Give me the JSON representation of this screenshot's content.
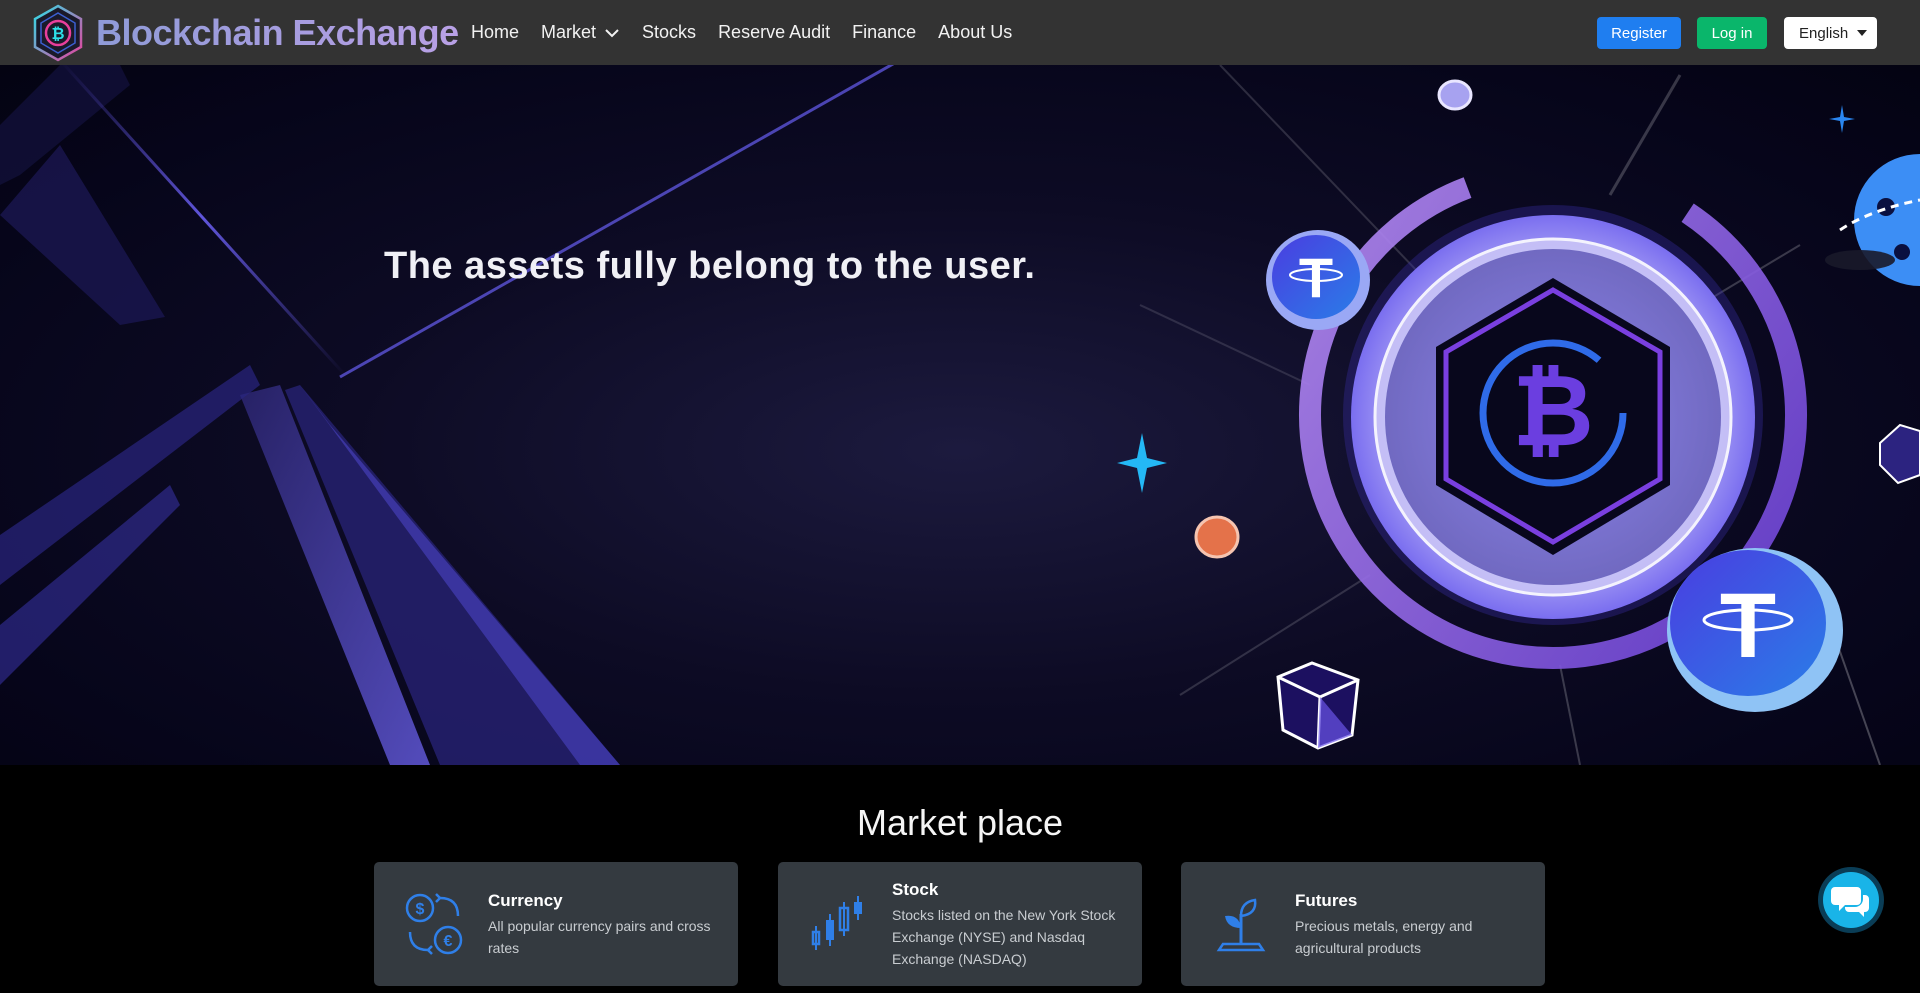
{
  "navbar": {
    "brand_title": "Blockchain Exchange",
    "logo_icon": "bitcoin-hexagon-icon",
    "menu": [
      {
        "label": "Home"
      },
      {
        "label": "Market",
        "has_dropdown": true
      },
      {
        "label": "Stocks"
      },
      {
        "label": "Reserve Audit"
      },
      {
        "label": "Finance"
      },
      {
        "label": "About Us"
      }
    ],
    "register_label": "Register",
    "login_label": "Log in",
    "language": "English"
  },
  "hero": {
    "headline": "The assets fully belong to the user."
  },
  "market": {
    "heading": "Market place",
    "cards": [
      {
        "title": "Currency",
        "description": "All popular currency pairs and cross rates",
        "icon": "currency-exchange-icon"
      },
      {
        "title": "Stock",
        "description": "Stocks listed on the New York Stock Exchange (NYSE) and Nasdaq Exchange (NASDAQ)",
        "icon": "candlestick-chart-icon"
      },
      {
        "title": "Futures",
        "description": "Precious metals, energy and agricultural products",
        "icon": "plant-growth-icon"
      }
    ]
  },
  "chat": {
    "icon": "chat-bubbles-icon"
  },
  "colors": {
    "navbar_bg": "#333333",
    "register": "#1f7ef0",
    "login": "#0ab66b",
    "card_bg": "#343a40",
    "icon_blue": "#2f7fe8"
  }
}
